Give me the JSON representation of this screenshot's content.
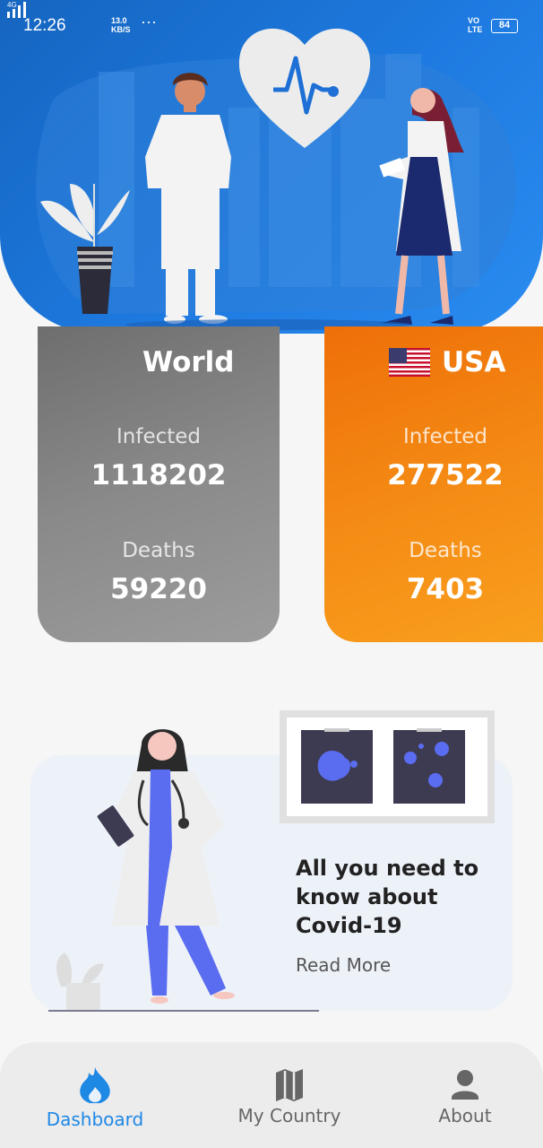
{
  "status_bar": {
    "time": "12:26",
    "network": "4G",
    "speed_value": "13.0",
    "speed_unit": "KB/S",
    "more": "···",
    "volte_top": "VO",
    "volte_bottom": "LTE",
    "battery": "84"
  },
  "cards": {
    "world": {
      "title": "World",
      "infected_label": "Infected",
      "infected_value": "1118202",
      "deaths_label": "Deaths",
      "deaths_value": "59220"
    },
    "usa": {
      "title": "USA",
      "infected_label": "Infected",
      "infected_value": "277522",
      "deaths_label": "Deaths",
      "deaths_value": "7403"
    }
  },
  "info_card": {
    "headline_line1": "All you need to",
    "headline_line2": "know about",
    "headline_line3": "Covid-19",
    "read_more": "Read More"
  },
  "nav": {
    "items": [
      {
        "label": "Dashboard",
        "icon": "flame-icon",
        "active": true
      },
      {
        "label": "My Country",
        "icon": "map-icon",
        "active": false
      },
      {
        "label": "About",
        "icon": "person-icon",
        "active": false
      }
    ]
  },
  "colors": {
    "header_blue": "#1e7ae0",
    "world_gray": "#808080",
    "usa_orange": "#f48a14",
    "active_nav": "#1e88e5"
  }
}
